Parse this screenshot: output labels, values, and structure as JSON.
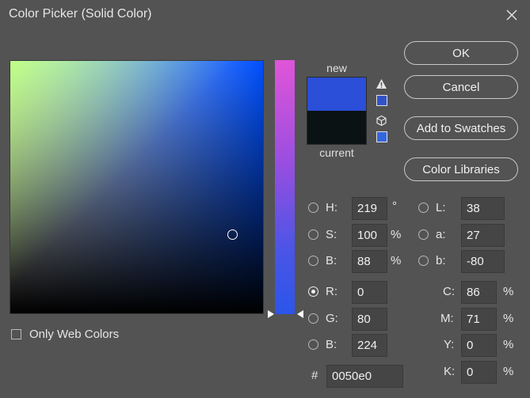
{
  "window": {
    "title": "Color Picker (Solid Color)"
  },
  "swatches": {
    "new_label": "new",
    "current_label": "current",
    "new_color": "#2b4fd8",
    "current_color": "#0a1214"
  },
  "buttons": {
    "ok": "OK",
    "cancel": "Cancel",
    "add_to_swatches": "Add to Swatches",
    "color_libraries": "Color Libraries"
  },
  "hsb": {
    "h": {
      "label": "H:",
      "value": "219",
      "unit": "°"
    },
    "s": {
      "label": "S:",
      "value": "100",
      "unit": "%"
    },
    "b": {
      "label": "B:",
      "value": "88",
      "unit": "%"
    }
  },
  "rgb": {
    "r": {
      "label": "R:",
      "value": "0"
    },
    "g": {
      "label": "G:",
      "value": "80"
    },
    "b": {
      "label": "B:",
      "value": "224"
    }
  },
  "lab": {
    "l": {
      "label": "L:",
      "value": "38"
    },
    "a": {
      "label": "a:",
      "value": "27"
    },
    "b": {
      "label": "b:",
      "value": "-80"
    }
  },
  "cmyk": {
    "c": {
      "label": "C:",
      "value": "86",
      "unit": "%"
    },
    "m": {
      "label": "M:",
      "value": "71",
      "unit": "%"
    },
    "y": {
      "label": "Y:",
      "value": "0",
      "unit": "%"
    },
    "k": {
      "label": "K:",
      "value": "0",
      "unit": "%"
    }
  },
  "hex": {
    "label": "#",
    "value": "0050e0"
  },
  "web_colors": {
    "label": "Only Web Colors"
  },
  "selected_mode": "R"
}
